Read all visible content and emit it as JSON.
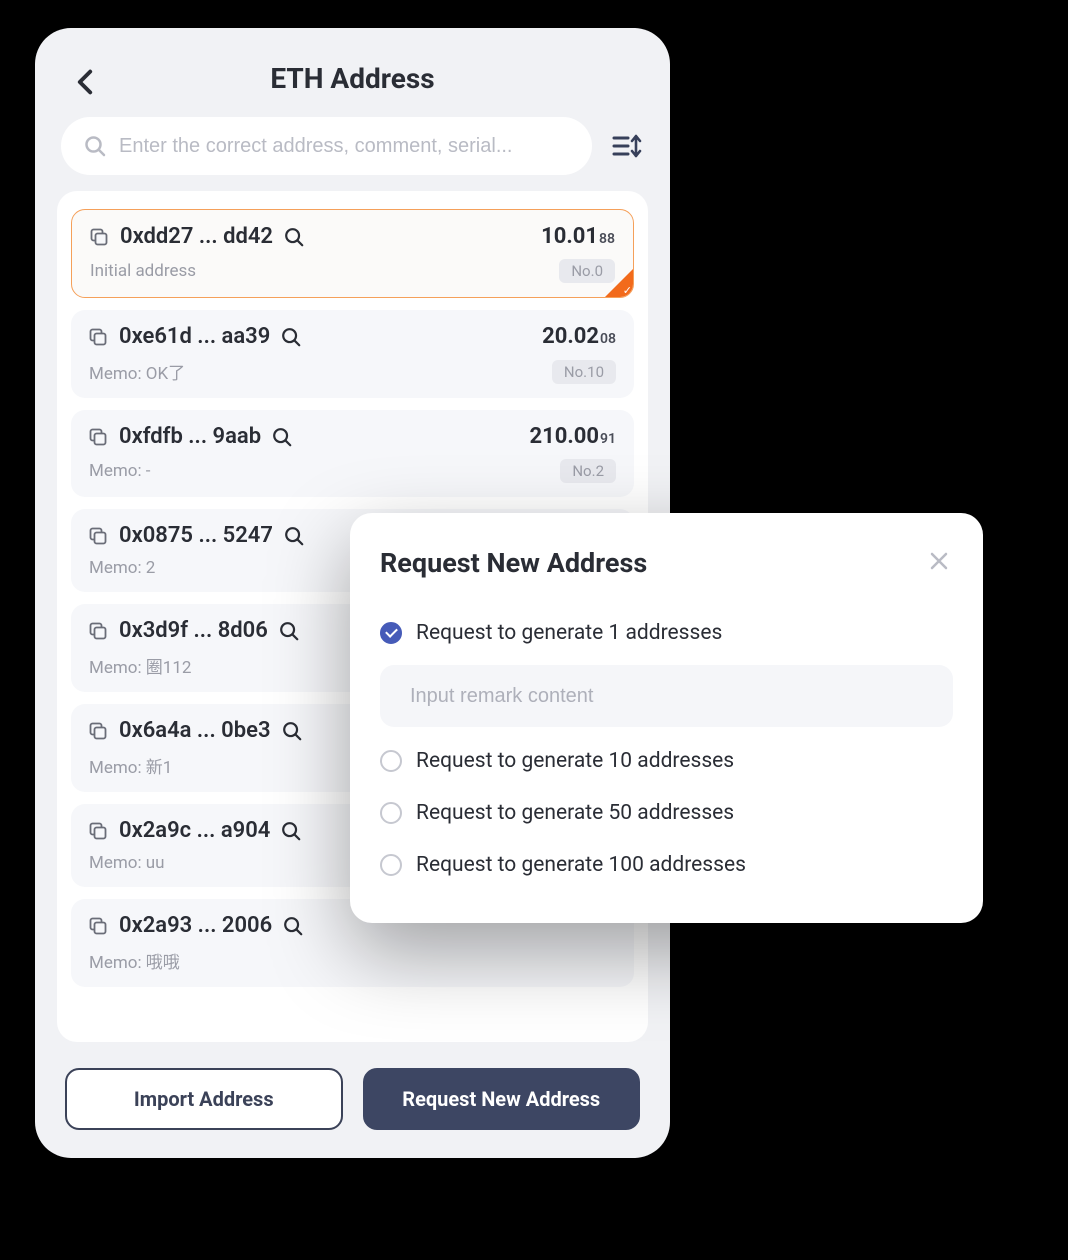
{
  "header": {
    "title": "ETH Address"
  },
  "search": {
    "placeholder": "Enter the correct address, comment, serial..."
  },
  "addresses": [
    {
      "address": "0xdd27 ... dd42",
      "balance_main": "10.01",
      "balance_sub": "88",
      "memo": "Initial address",
      "badge": "No.0",
      "selected": true
    },
    {
      "address": "0xe61d ... aa39",
      "balance_main": "20.02",
      "balance_sub": "08",
      "memo": "Memo: OK了",
      "badge": "No.10",
      "selected": false
    },
    {
      "address": "0xfdfb ... 9aab",
      "balance_main": "210.00",
      "balance_sub": "91",
      "memo": "Memo: -",
      "badge": "No.2",
      "selected": false
    },
    {
      "address": "0x0875 ... 5247",
      "balance_main": "",
      "balance_sub": "",
      "memo": "Memo: 2",
      "badge": "",
      "selected": false
    },
    {
      "address": "0x3d9f ... 8d06",
      "balance_main": "",
      "balance_sub": "",
      "memo": "Memo: 圈112",
      "badge": "",
      "selected": false
    },
    {
      "address": "0x6a4a ... 0be3",
      "balance_main": "",
      "balance_sub": "",
      "memo": "Memo: 新1",
      "badge": "",
      "selected": false
    },
    {
      "address": "0x2a9c ... a904",
      "balance_main": "",
      "balance_sub": "",
      "memo": "Memo: uu",
      "badge": "",
      "selected": false
    },
    {
      "address": "0x2a93 ... 2006",
      "balance_main": "",
      "balance_sub": "",
      "memo": "Memo: 哦哦",
      "badge": "",
      "selected": false
    }
  ],
  "buttons": {
    "import": "Import Address",
    "request": "Request New Address"
  },
  "modal": {
    "title": "Request New Address",
    "remark_placeholder": "Input remark content",
    "options": [
      {
        "label": "Request to generate 1 addresses",
        "checked": true
      },
      {
        "label": "Request to generate 10 addresses",
        "checked": false
      },
      {
        "label": "Request to generate 50 addresses",
        "checked": false
      },
      {
        "label": "Request to generate 100 addresses",
        "checked": false
      }
    ]
  }
}
